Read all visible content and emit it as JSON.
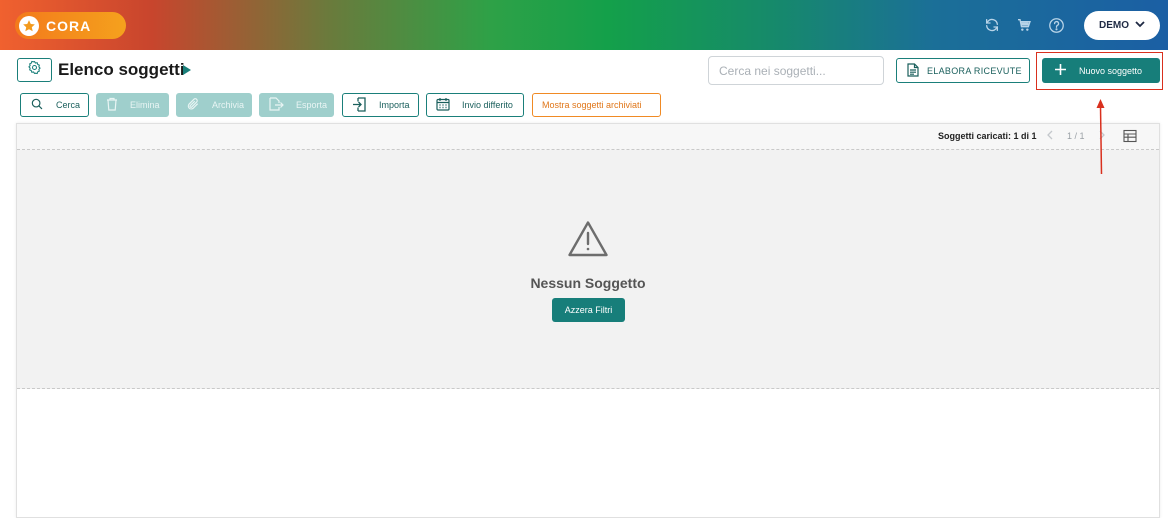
{
  "header": {
    "logo_text": "CORA",
    "icons": [
      "refresh-icon",
      "cart-icon",
      "help-icon"
    ],
    "user_label": "DEMO"
  },
  "title_row": {
    "title": "Elenco soggetti",
    "search_placeholder": "Cerca nei soggetti...",
    "elabora_label": "ELABORA RICEVUTE",
    "new_label": "Nuovo soggetto"
  },
  "toolbar": {
    "cerca": "Cerca",
    "elimina": "Elimina",
    "archivia": "Archivia",
    "esporta": "Esporta",
    "importa": "Importa",
    "invio_differito": "Invio differito",
    "mostra_archiviati": "Mostra soggetti archiviati"
  },
  "panel": {
    "loaded_text": "Soggetti caricati: 1 di 1",
    "page_indicator": "1 / 1",
    "empty_title": "Nessun Soggetto",
    "reset_label": "Azzera Filtri"
  },
  "colors": {
    "primary": "#177e7a",
    "orange": "#f08a24",
    "highlight": "#d9301e"
  }
}
